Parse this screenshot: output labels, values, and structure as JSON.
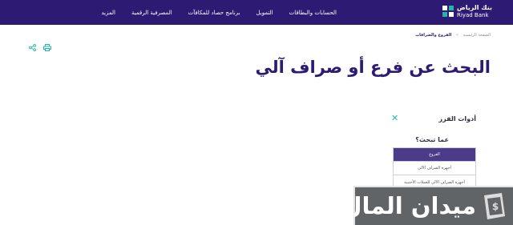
{
  "header": {
    "logo_ar": "بنك الرياض",
    "logo_en": "Riyad Bank",
    "nav": [
      "الحسابات والبطاقات",
      "التمويل",
      "برنامج حصاد للمكافآت",
      "المصرفية الرقمية",
      "المزيد"
    ]
  },
  "breadcrumb": {
    "home": "الصفحة الرئيسية",
    "separator": ">",
    "current": "الفروع والصرافات"
  },
  "page": {
    "title": "البحث عن فرع أو صراف آلي"
  },
  "filter": {
    "title": "أدوات الفرز",
    "close_icon": "close-icon",
    "question": "عما تبحث؟",
    "options": [
      "الفروع",
      "أجهزة الصراف الآلي",
      "أجهزة الصراف الآلي للعملات الأجنبية"
    ],
    "selected_index": 0
  },
  "tools": {
    "share_icon": "share-icon",
    "print_icon": "print-icon"
  },
  "watermark": {
    "text": "ميدان المال"
  },
  "colors": {
    "brand": "#2d1a73",
    "accent": "#21b7a6",
    "selected_option": "#4b3c8a"
  }
}
